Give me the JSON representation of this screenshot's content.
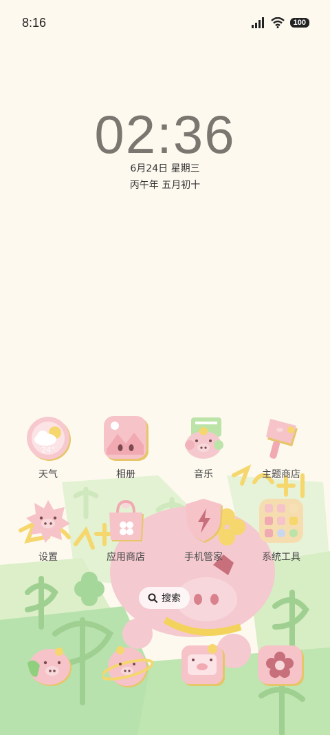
{
  "status_bar": {
    "time": "8:16",
    "battery": "100"
  },
  "lockclock": {
    "time": "02:36",
    "date": "6月24日 星期三",
    "lunar": "丙午年 五月初十"
  },
  "weather_icon_temp": "24°",
  "apps_row1": [
    {
      "label": "天气"
    },
    {
      "label": "相册"
    },
    {
      "label": "音乐"
    },
    {
      "label": "主题商店"
    }
  ],
  "apps_row2": [
    {
      "label": "设置"
    },
    {
      "label": "应用商店"
    },
    {
      "label": "手机管家"
    },
    {
      "label": "系统工具"
    }
  ],
  "search": {
    "label": "搜索"
  },
  "colors": {
    "pink": "#f6c6cc",
    "green": "#c9e8b4",
    "yellow": "#f5d76e",
    "bg": "#fdf9ef"
  }
}
